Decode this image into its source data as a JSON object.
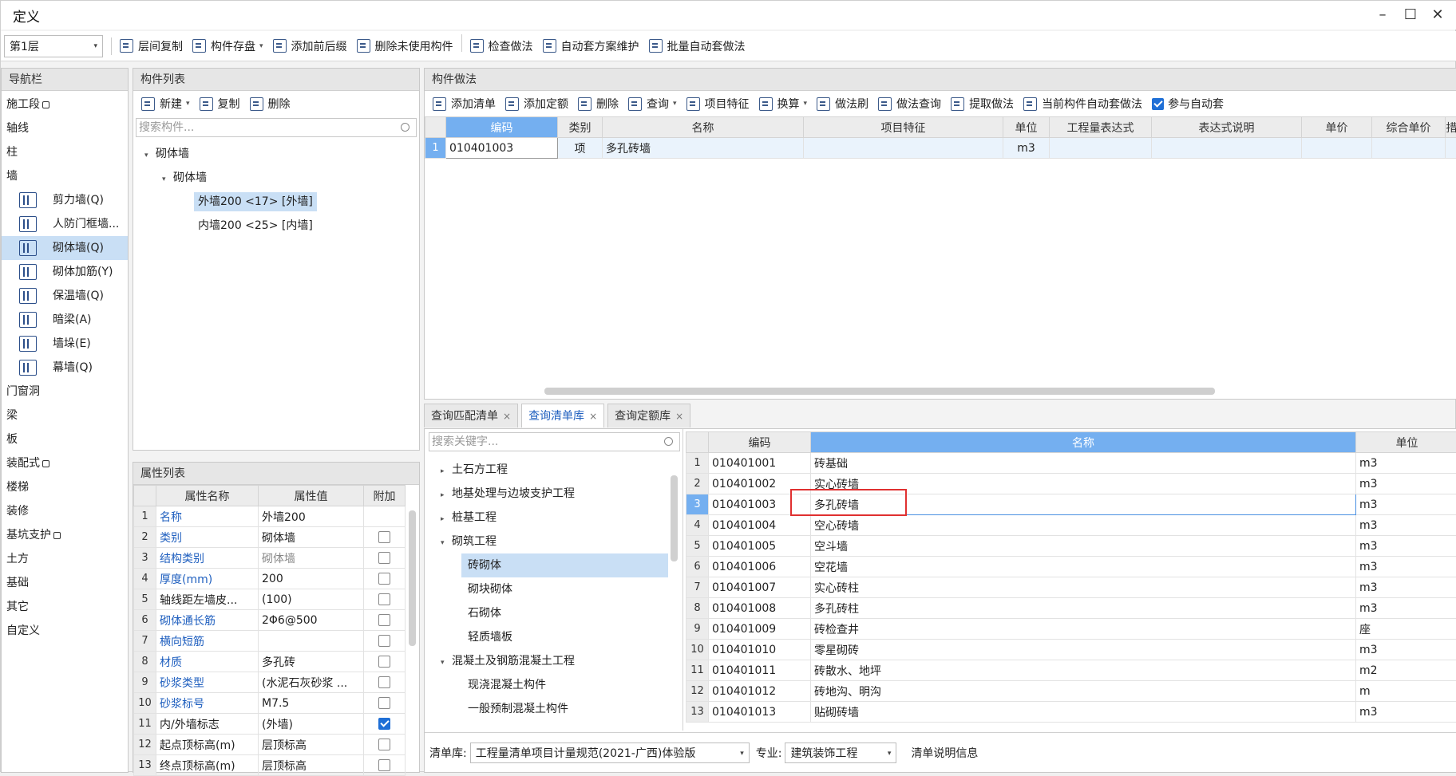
{
  "window": {
    "title": "定义"
  },
  "toolbar": {
    "floor": "第1层",
    "items": [
      "层间复制",
      "构件存盘",
      "添加前后缀",
      "删除未使用构件",
      "检查做法",
      "自动套方案维护",
      "批量自动套做法"
    ]
  },
  "nav": {
    "title": "导航栏",
    "items": [
      {
        "label": "施工段",
        "lock": true,
        "sub": false
      },
      {
        "label": "轴线",
        "sub": false
      },
      {
        "label": "柱",
        "sub": false
      },
      {
        "label": "墙",
        "sub": false
      },
      {
        "label": "剪力墙(Q)",
        "sub": true
      },
      {
        "label": "人防门框墙...",
        "sub": true
      },
      {
        "label": "砌体墙(Q)",
        "sub": true,
        "selected": true
      },
      {
        "label": "砌体加筋(Y)",
        "sub": true
      },
      {
        "label": "保温墙(Q)",
        "sub": true
      },
      {
        "label": "暗梁(A)",
        "sub": true
      },
      {
        "label": "墙垛(E)",
        "sub": true
      },
      {
        "label": "幕墙(Q)",
        "sub": true
      },
      {
        "label": "门窗洞",
        "sub": false
      },
      {
        "label": "梁",
        "sub": false
      },
      {
        "label": "板",
        "sub": false
      },
      {
        "label": "装配式",
        "lock": true,
        "sub": false
      },
      {
        "label": "楼梯",
        "sub": false
      },
      {
        "label": "装修",
        "sub": false
      },
      {
        "label": "基坑支护",
        "lock": true,
        "sub": false
      },
      {
        "label": "土方",
        "sub": false
      },
      {
        "label": "基础",
        "sub": false
      },
      {
        "label": "其它",
        "sub": false
      },
      {
        "label": "自定义",
        "sub": false
      }
    ]
  },
  "comp": {
    "title": "构件列表",
    "new_label": "新建",
    "copy_label": "复制",
    "delete_label": "删除",
    "search_placeholder": "搜索构件...",
    "root": "砌体墙",
    "group": "砌体墙",
    "items": [
      "外墙200 <17> [外墙]",
      "内墙200 <25> [内墙]"
    ]
  },
  "props": {
    "title": "属性列表",
    "headers": [
      "属性名称",
      "属性值",
      "附加"
    ],
    "rows": [
      [
        "1",
        "名称",
        "外墙200",
        false,
        "blue",
        false
      ],
      [
        "2",
        "类别",
        "砌体墙",
        true,
        "blue",
        false
      ],
      [
        "3",
        "结构类别",
        "砌体墙",
        true,
        "blue",
        false
      ],
      [
        "4",
        "厚度(mm)",
        "200",
        true,
        "blue",
        false
      ],
      [
        "5",
        "轴线距左墙皮...",
        "(100)",
        true,
        "",
        false
      ],
      [
        "6",
        "砌体通长筋",
        "2Φ6@500",
        true,
        "blue",
        false
      ],
      [
        "7",
        "横向短筋",
        "",
        true,
        "blue",
        false
      ],
      [
        "8",
        "材质",
        "多孔砖",
        true,
        "blue",
        false
      ],
      [
        "9",
        "砂浆类型",
        "(水泥石灰砂浆 ...",
        true,
        "blue",
        false
      ],
      [
        "10",
        "砂浆标号",
        "M7.5",
        true,
        "blue",
        false
      ],
      [
        "11",
        "内/外墙标志",
        "(外墙)",
        true,
        "",
        true
      ],
      [
        "12",
        "起点顶标高(m)",
        "层顶标高",
        true,
        "",
        false
      ],
      [
        "13",
        "终点顶标高(m)",
        "层顶标高",
        true,
        "",
        false
      ]
    ]
  },
  "method": {
    "title": "构件做法",
    "buttons": [
      "添加清单",
      "添加定额",
      "删除",
      "查询",
      "项目特征",
      "换算",
      "做法刷",
      "做法查询",
      "提取做法",
      "当前构件自动套做法"
    ],
    "auto_label": "参与自动套",
    "auto_checked": true,
    "headers": [
      "编码",
      "类别",
      "名称",
      "项目特征",
      "单位",
      "工程量表达式",
      "表达式说明",
      "单价",
      "综合单价",
      "措"
    ],
    "rows": [
      [
        "1",
        "010401003",
        "项",
        "多孔砖墙",
        "",
        "m3",
        "",
        "",
        "",
        ""
      ]
    ]
  },
  "tabs": [
    {
      "label": "查询匹配清单",
      "active": false
    },
    {
      "label": "查询清单库",
      "active": true
    },
    {
      "label": "查询定额库",
      "active": false
    }
  ],
  "lib": {
    "search_placeholder": "搜索关键字...",
    "tree": [
      {
        "label": "土石方工程",
        "lvl": 0,
        "tri": "▸"
      },
      {
        "label": "地基处理与边坡支护工程",
        "lvl": 0,
        "tri": "▸"
      },
      {
        "label": "桩基工程",
        "lvl": 0,
        "tri": "▸"
      },
      {
        "label": "砌筑工程",
        "lvl": 0,
        "tri": "▾"
      },
      {
        "label": "砖砌体",
        "lvl": 1,
        "sel": true
      },
      {
        "label": "砌块砌体",
        "lvl": 1
      },
      {
        "label": "石砌体",
        "lvl": 1
      },
      {
        "label": "轻质墙板",
        "lvl": 1
      },
      {
        "label": "混凝土及钢筋混凝土工程",
        "lvl": 0,
        "tri": "▾"
      },
      {
        "label": "现浇混凝土构件",
        "lvl": 1
      },
      {
        "label": "一般预制混凝土构件",
        "lvl": 1
      }
    ],
    "headers": [
      "编码",
      "名称",
      "单位"
    ],
    "rows": [
      [
        "1",
        "010401001",
        "砖基础",
        "m3"
      ],
      [
        "2",
        "010401002",
        "实心砖墙",
        "m3"
      ],
      [
        "3",
        "010401003",
        "多孔砖墙",
        "m3"
      ],
      [
        "4",
        "010401004",
        "空心砖墙",
        "m3"
      ],
      [
        "5",
        "010401005",
        "空斗墙",
        "m3"
      ],
      [
        "6",
        "010401006",
        "空花墙",
        "m3"
      ],
      [
        "7",
        "010401007",
        "实心砖柱",
        "m3"
      ],
      [
        "8",
        "010401008",
        "多孔砖柱",
        "m3"
      ],
      [
        "9",
        "010401009",
        "砖检查井",
        "座"
      ],
      [
        "10",
        "010401010",
        "零星砌砖",
        "m3"
      ],
      [
        "11",
        "010401011",
        "砖散水、地坪",
        "m2"
      ],
      [
        "12",
        "010401012",
        "砖地沟、明沟",
        "m"
      ],
      [
        "13",
        "010401013",
        "贴砌砖墙",
        "m3"
      ]
    ],
    "bottom": {
      "lib_label": "清单库:",
      "lib_value": "工程量清单项目计量规范(2021-广西)体验版",
      "spec_label": "专业:",
      "spec_value": "建筑装饰工程",
      "info_label": "清单说明信息"
    }
  },
  "colors": {
    "selected": "#c9dff5",
    "header_blue": "#74aff0",
    "accent": "#1f5fbf",
    "highlight_box": "#e03030"
  }
}
